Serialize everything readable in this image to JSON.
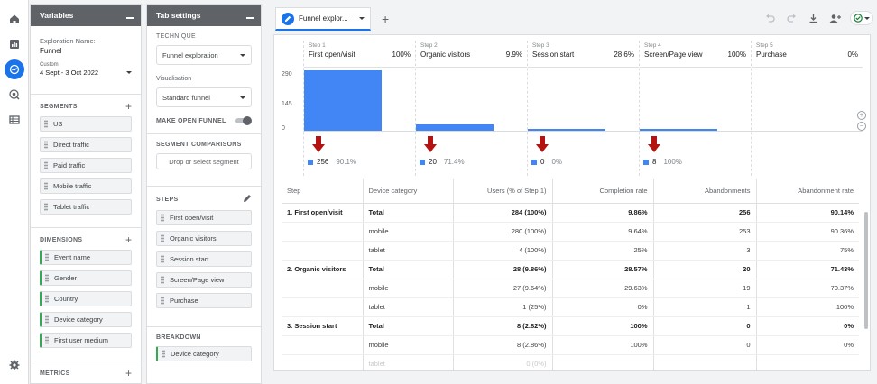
{
  "variables": {
    "header": "Variables",
    "exploration_label": "Exploration Name:",
    "exploration_name": "Funnel",
    "date_tag": "Custom",
    "date_range": "4 Sept - 3 Oct 2022",
    "segments_label": "SEGMENTS",
    "segments": [
      "US",
      "Direct traffic",
      "Paid traffic",
      "Mobile traffic",
      "Tablet traffic"
    ],
    "dimensions_label": "DIMENSIONS",
    "dimensions": [
      "Event name",
      "Gender",
      "Country",
      "Device category",
      "First user medium"
    ],
    "metrics_label": "METRICS"
  },
  "tab_settings": {
    "header": "Tab settings",
    "technique_label": "TECHNIQUE",
    "technique": "Funnel exploration",
    "visualisation_label": "Visualisation",
    "visualisation": "Standard funnel",
    "open_funnel_label": "MAKE OPEN FUNNEL",
    "segment_comparisons_label": "SEGMENT COMPARISONS",
    "segment_drop": "Drop or select segment",
    "steps_label": "STEPS",
    "steps": [
      "First open/visit",
      "Organic visitors",
      "Session start",
      "Screen/Page view",
      "Purchase"
    ],
    "breakdown_label": "BREAKDOWN",
    "breakdown": "Device category"
  },
  "canvas": {
    "tab_title": "Funnel explor...",
    "chart_data": {
      "type": "bar",
      "y_ticks": [
        "290",
        "145",
        "0"
      ],
      "ylim": [
        0,
        290
      ],
      "steps": [
        {
          "num": "Step 1",
          "name": "First open/visit",
          "pct": "100%",
          "value": 284,
          "foot_value": "256",
          "foot_pct": "90.1%",
          "arrow": true
        },
        {
          "num": "Step 2",
          "name": "Organic visitors",
          "pct": "9.9%",
          "value": 28,
          "foot_value": "20",
          "foot_pct": "71.4%",
          "arrow": true
        },
        {
          "num": "Step 3",
          "name": "Session start",
          "pct": "28.6%",
          "value": 8,
          "foot_value": "0",
          "foot_pct": "0%",
          "arrow": true
        },
        {
          "num": "Step 4",
          "name": "Screen/Page view",
          "pct": "100%",
          "value": 8,
          "foot_value": "8",
          "foot_pct": "100%",
          "arrow": true
        },
        {
          "num": "Step 5",
          "name": "Purchase",
          "pct": "0%",
          "value": 0,
          "foot_value": "",
          "foot_pct": "",
          "arrow": false
        }
      ]
    },
    "table": {
      "headers": [
        "Step",
        "Device category",
        "Users (% of Step 1)",
        "Completion rate",
        "Abandonments",
        "Abandonment rate"
      ],
      "rows": [
        {
          "type": "total",
          "cells": [
            "1. First open/visit",
            "Total",
            "284 (100%)",
            "9.86%",
            "256",
            "90.14%"
          ]
        },
        {
          "type": "sub",
          "cells": [
            "",
            "mobile",
            "280 (100%)",
            "9.64%",
            "253",
            "90.36%"
          ]
        },
        {
          "type": "sub",
          "cells": [
            "",
            "tablet",
            "4 (100%)",
            "25%",
            "3",
            "75%"
          ]
        },
        {
          "type": "total",
          "cells": [
            "2. Organic visitors",
            "Total",
            "28 (9.86%)",
            "28.57%",
            "20",
            "71.43%"
          ]
        },
        {
          "type": "sub",
          "cells": [
            "",
            "mobile",
            "27 (9.64%)",
            "29.63%",
            "19",
            "70.37%"
          ]
        },
        {
          "type": "sub",
          "cells": [
            "",
            "tablet",
            "1 (25%)",
            "0%",
            "1",
            "100%"
          ]
        },
        {
          "type": "total",
          "cells": [
            "3. Session start",
            "Total",
            "8 (2.82%)",
            "100%",
            "0",
            "0%"
          ]
        },
        {
          "type": "sub",
          "cells": [
            "",
            "mobile",
            "8 (2.86%)",
            "100%",
            "0",
            "0%"
          ]
        },
        {
          "type": "fade",
          "cells": [
            "",
            "tablet",
            "0 (0%)",
            "",
            "",
            ""
          ]
        }
      ]
    }
  }
}
